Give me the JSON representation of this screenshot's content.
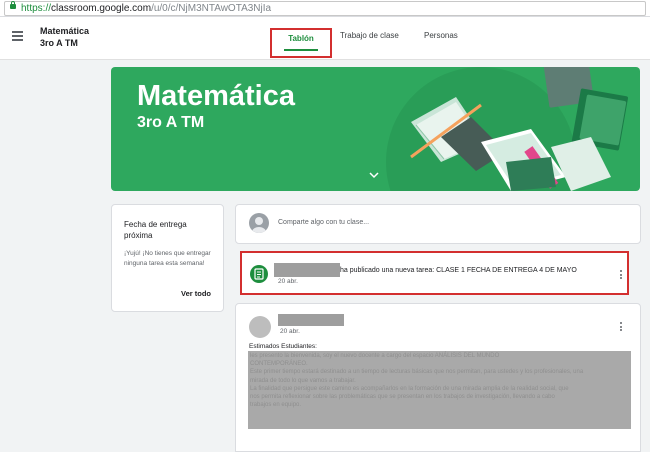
{
  "browser": {
    "url_protocol": "https://",
    "url_host": "classroom.google.com",
    "url_path": "/u/0/c/NjM3NTAwOTA3NjIa"
  },
  "header": {
    "title_line1": "Matemática",
    "title_line2": "3ro A TM",
    "tabs": [
      {
        "label": "Tablón",
        "active": true
      },
      {
        "label": "Trabajo de clase",
        "active": false
      },
      {
        "label": "Personas",
        "active": false
      }
    ]
  },
  "banner": {
    "title": "Matemática",
    "subtitle": "3ro A TM",
    "color": "#2ea85e"
  },
  "upcoming": {
    "title": "Fecha de entrega próxima",
    "body": "¡Yujú! ¡No tienes que entregar ninguna tarea esta semana!",
    "link": "Ver todo"
  },
  "composer": {
    "placeholder": "Comparte algo con tu clase..."
  },
  "posts": [
    {
      "text": "ha publicado una nueva tarea: CLASE 1 FECHA DE ENTREGA 4 DE MAYO",
      "date": "20 abr."
    },
    {
      "date": "20 abr.",
      "greeting": "Estimados Estudiantes:",
      "body_lines": [
        "les presento la bienvenida, soy el nuevo docente a cargo del espacio ANÁLISIS DEL MUNDO",
        "CONTEMPORÁNEO.",
        "Este primer tiempo estará destinado a un tiempo de lecturas básicas que nos permitan, para ustedes y los profesionales, una",
        "mirada de todo lo que vamos a trabajar.",
        "La finalidad que persigue este camino es acompañarlos en la formación de una mirada amplia de la realidad social, que",
        "nos permita reflexionar sobre las problemáticas que se presentan en los trabajos de investigación, llevando a cabo",
        "trabajos en equipo."
      ]
    }
  ],
  "colors": {
    "accent": "#1e8e3e",
    "highlight_box": "#d32f2f"
  }
}
